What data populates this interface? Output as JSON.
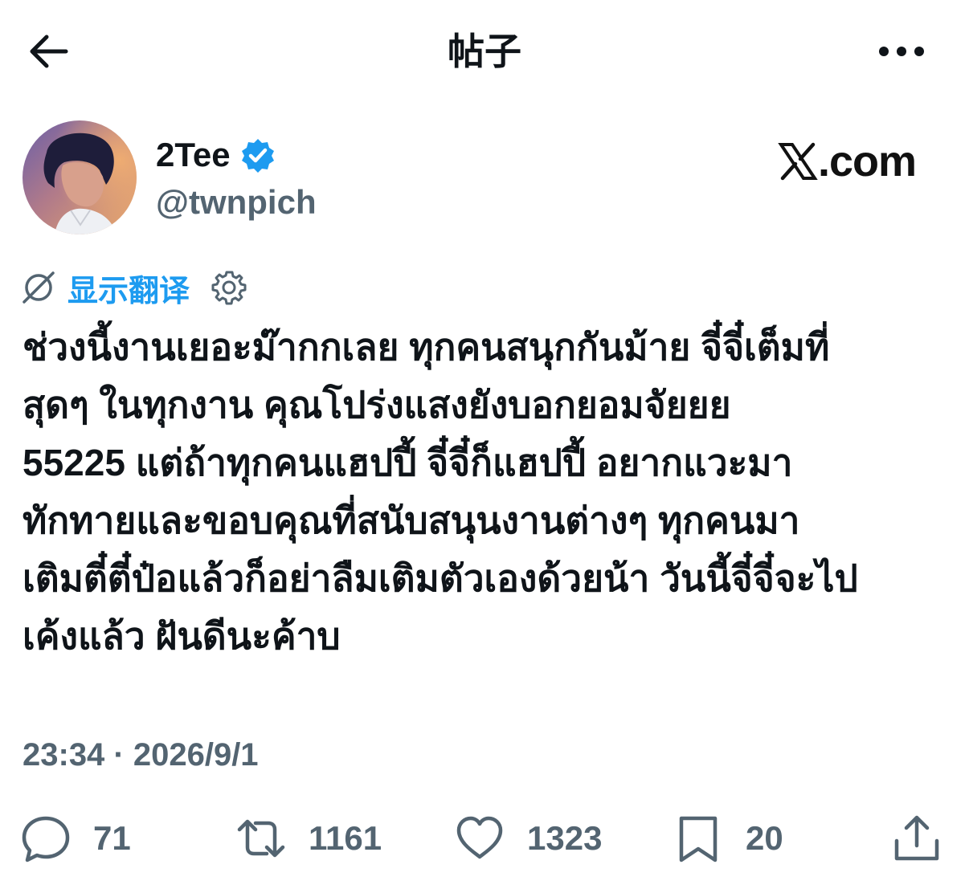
{
  "header": {
    "title": "帖子",
    "back_icon": "arrow-left-icon",
    "more_icon": "more-horizontal-icon"
  },
  "author": {
    "display_name": "2Tee",
    "handle": "@twnpich",
    "verified_icon": "verified-badge-icon",
    "verified_color": "#1d9bf0"
  },
  "watermark": {
    "text": ".com"
  },
  "translate": {
    "label": "显示翻译",
    "icon": "translate-off-icon",
    "settings_icon": "gear-icon"
  },
  "post": {
    "text": "ช่วงนี้งานเยอะม๊ากกเลย ทุกคนสนุกกันม้าย จี๋จี๋เต็มที่\nสุดๆ ในทุกงาน คุณโปร่งแสงยังบอกยอมจัยยย\n55225 แต่ถ้าทุกคนแฮปปี้ จี๋จี๋ก็แฮปปี้ อยากแวะมา\nทักทายและขอบคุณที่สนับสนุนงานต่างๆ ทุกคนมา\nเติมตี๋ตี๋ป๋อแล้วก็อย่าลืมเติมตัวเองด้วยน้า วันนี้จี๋จี๋จะไป\nเค้งแล้ว ฝันดีนะค้าบ",
    "timestamp": "23:34 · 2026/9/1"
  },
  "actions": {
    "reply": {
      "icon": "reply-icon",
      "count": "71"
    },
    "repost": {
      "icon": "repost-icon",
      "count": "1161"
    },
    "like": {
      "icon": "heart-icon",
      "count": "1323"
    },
    "bookmark": {
      "icon": "bookmark-icon",
      "count": "20"
    },
    "share": {
      "icon": "share-icon"
    }
  },
  "colors": {
    "accent": "#1d9bf0",
    "text_primary": "#0f1419",
    "text_secondary": "#536471"
  }
}
